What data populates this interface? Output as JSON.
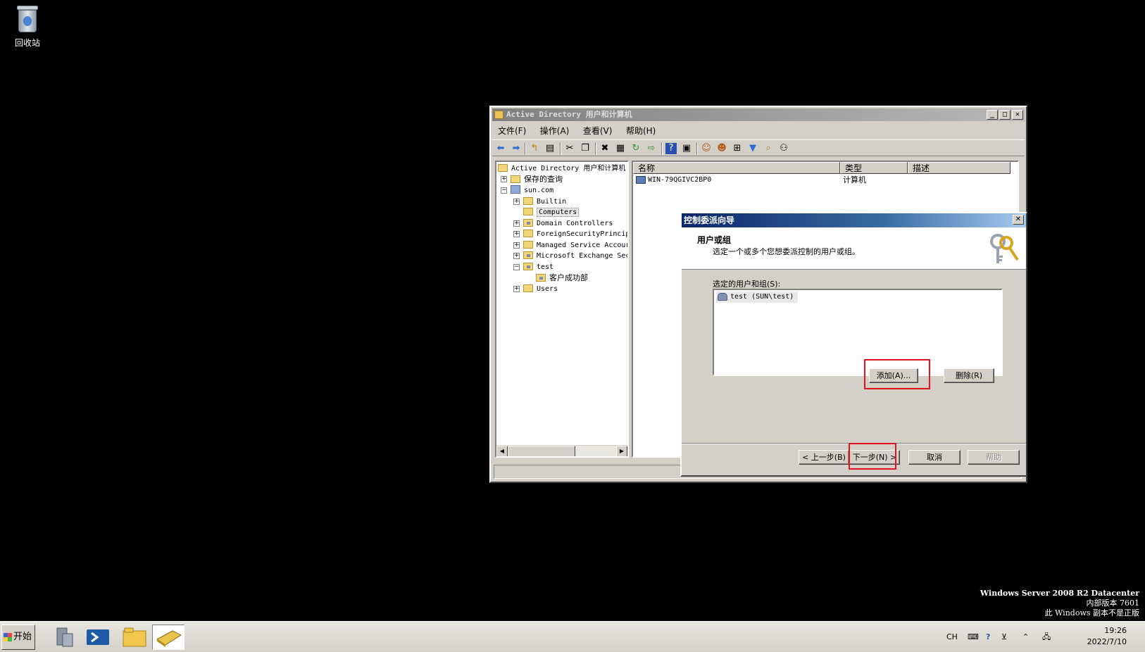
{
  "desktop": {
    "recycle_bin_label": "回收站"
  },
  "main_window": {
    "title": "Active Directory 用户和计算机",
    "title_controls": {
      "minimize": "_",
      "maximize": "□",
      "close": "✕"
    },
    "menu": [
      "文件(F)",
      "操作(A)",
      "查看(V)",
      "帮助(H)"
    ],
    "toolbar_icons": [
      "back-icon",
      "forward-icon",
      "up-icon",
      "show-hide-console-tree-icon",
      "cut-icon",
      "copy-icon",
      "delete-icon",
      "properties-icon",
      "refresh-icon",
      "export-list-icon",
      "help-icon",
      "view-icon",
      "new-user-icon",
      "new-group-icon",
      "new-ou-icon",
      "filter-icon",
      "find-icon",
      "add-to-group-icon"
    ],
    "tree": {
      "root": "Active Directory 用户和计算机",
      "saved_queries": "保存的查询",
      "domain": "sun.com",
      "children": [
        "Builtin",
        "Computers",
        "Domain Controllers",
        "ForeignSecurityPrincip",
        "Managed Service Accour",
        "Microsoft Exchange Sec",
        "test",
        "Users"
      ],
      "test_child": "客户成功部",
      "selected": "Computers"
    },
    "list": {
      "columns": [
        "名称",
        "类型",
        "描述"
      ],
      "rows": [
        {
          "name": "WIN-79QGIVC2BP0",
          "type": "计算机",
          "description": ""
        }
      ]
    }
  },
  "wizard": {
    "title": "控制委派向导",
    "close": "✕",
    "heading": "用户或组",
    "subheading": "选定一个或多个您想委派控制的用户或组。",
    "selected_label": "选定的用户和组(S):",
    "selected_items": [
      "test (SUN\\test)"
    ],
    "add_button": "添加(A)...",
    "remove_button": "删除(R)",
    "back_button": "< 上一步(B)",
    "next_button": "下一步(N) >",
    "cancel_button": "取消",
    "help_button": "帮助"
  },
  "watermark": {
    "line1": "Windows Server 2008 R2 Datacenter",
    "line2": "内部版本 7601",
    "line3": "此 Windows 副本不是正版"
  },
  "taskbar": {
    "start_label": "开始",
    "language": "CH",
    "time": "19:26",
    "date": "2022/7/10"
  },
  "colors": {
    "highlight_box": "#e0141e",
    "dialog_title": "#0a246a",
    "desktop": "#000000"
  }
}
